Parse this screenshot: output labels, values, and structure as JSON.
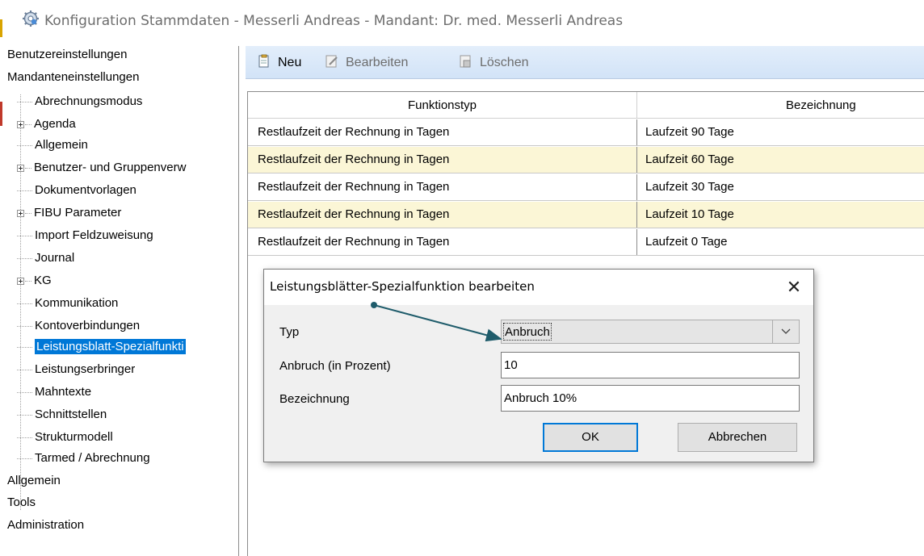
{
  "window": {
    "title": "Konfiguration Stammdaten - Messerli Andreas - Mandant: Dr. med. Messerli Andreas",
    "icon": "settings-gear-icon"
  },
  "tree": {
    "items": [
      {
        "label": "Benutzereinstellungen",
        "level": 0,
        "expandable": false
      },
      {
        "label": "Mandanteneinstellungen",
        "level": 0,
        "expandable": false
      },
      {
        "label": "Abrechnungsmodus",
        "level": 1,
        "expandable": false
      },
      {
        "label": "Agenda",
        "level": 1,
        "expandable": true
      },
      {
        "label": "Allgemein",
        "level": 1,
        "expandable": false
      },
      {
        "label": "Benutzer- und Gruppenverw",
        "level": 1,
        "expandable": true
      },
      {
        "label": "Dokumentvorlagen",
        "level": 1,
        "expandable": false
      },
      {
        "label": "FIBU Parameter",
        "level": 1,
        "expandable": true
      },
      {
        "label": "Import Feldzuweisung",
        "level": 1,
        "expandable": false
      },
      {
        "label": "Journal",
        "level": 1,
        "expandable": false
      },
      {
        "label": "KG",
        "level": 1,
        "expandable": true
      },
      {
        "label": "Kommunikation",
        "level": 1,
        "expandable": false
      },
      {
        "label": "Kontoverbindungen",
        "level": 1,
        "expandable": false
      },
      {
        "label": "Leistungsblatt-Spezialfunkti",
        "level": 1,
        "expandable": false,
        "selected": true
      },
      {
        "label": "Leistungserbringer",
        "level": 1,
        "expandable": false
      },
      {
        "label": "Mahntexte",
        "level": 1,
        "expandable": false
      },
      {
        "label": "Schnittstellen",
        "level": 1,
        "expandable": false
      },
      {
        "label": "Strukturmodell",
        "level": 1,
        "expandable": false
      },
      {
        "label": "Tarmed / Abrechnung",
        "level": 1,
        "expandable": false
      },
      {
        "label": "Allgemein",
        "level": 0,
        "expandable": false
      },
      {
        "label": "Tools",
        "level": 0,
        "expandable": false
      },
      {
        "label": "Administration",
        "level": 0,
        "expandable": false
      }
    ]
  },
  "toolbar": {
    "new_label": "Neu",
    "edit_label": "Bearbeiten",
    "delete_label": "Löschen"
  },
  "grid": {
    "columns": [
      "Funktionstyp",
      "Bezeichnung"
    ],
    "rows": [
      {
        "funktionstyp": "Restlaufzeit der Rechnung in Tagen",
        "bezeichnung": "Laufzeit 90 Tage"
      },
      {
        "funktionstyp": "Restlaufzeit der Rechnung in Tagen",
        "bezeichnung": "Laufzeit 60 Tage"
      },
      {
        "funktionstyp": "Restlaufzeit der Rechnung in Tagen",
        "bezeichnung": "Laufzeit 30 Tage"
      },
      {
        "funktionstyp": "Restlaufzeit der Rechnung in Tagen",
        "bezeichnung": "Laufzeit 10 Tage"
      },
      {
        "funktionstyp": "Restlaufzeit der Rechnung in Tagen",
        "bezeichnung": "Laufzeit 0 Tage"
      }
    ]
  },
  "dialog": {
    "title": "Leistungsblätter-Spezialfunktion bearbeiten",
    "close_symbol": "✕",
    "typ_label": "Typ",
    "typ_value": "Anbruch",
    "anbruch_label": "Anbruch (in Prozent)",
    "anbruch_value": "10",
    "bezeichnung_label": "Bezeichnung",
    "bezeichnung_value": "Anbruch 10%",
    "ok_label": "OK",
    "cancel_label": "Abbrechen"
  },
  "colors": {
    "selection": "#0078d7",
    "row_alt": "#fbf6d6",
    "toolbar": "#dbe8f8",
    "annotation_arrow": "#1f5c6b"
  }
}
